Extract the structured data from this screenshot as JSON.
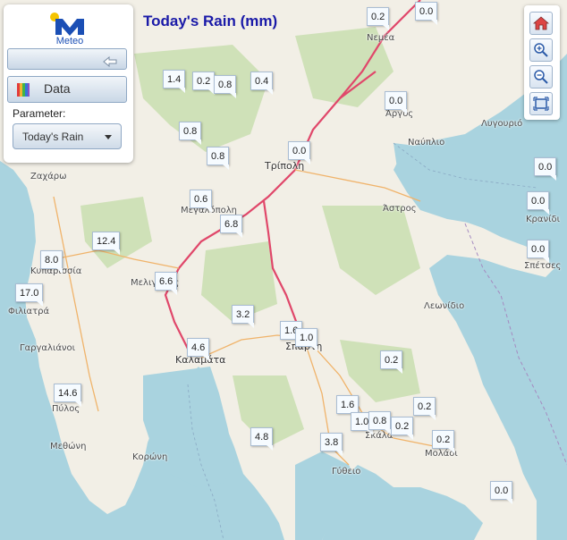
{
  "title": "Today's Rain (mm)",
  "panel": {
    "logo_text": "Meteo",
    "data_button": "Data",
    "parameter_label": "Parameter:",
    "parameter_value": "Today's Rain"
  },
  "toolbar": [
    "home-icon",
    "zoom-in-icon",
    "zoom-out-icon",
    "full-extent-icon"
  ],
  "colors": {
    "sea": "#a9d3df",
    "land": "#f2efe6",
    "forest": "#cfe1b8",
    "road": "#e0476a",
    "title": "#1a1aa8"
  },
  "markers": [
    {
      "value": "0.2"
    },
    {
      "value": "0.0"
    },
    {
      "value": "1.4"
    },
    {
      "value": "0.2"
    },
    {
      "value": "0.8"
    },
    {
      "value": "0.4"
    },
    {
      "value": "0.0"
    },
    {
      "value": "0.8"
    },
    {
      "value": "0.8"
    },
    {
      "value": "0.0"
    },
    {
      "value": "0.6"
    },
    {
      "value": "0.0"
    },
    {
      "value": "6.8"
    },
    {
      "value": "0.0"
    },
    {
      "value": "12.4"
    },
    {
      "value": "0.0"
    },
    {
      "value": "8.0"
    },
    {
      "value": "6.6"
    },
    {
      "value": "17.0"
    },
    {
      "value": "3.2"
    },
    {
      "value": "1.6"
    },
    {
      "value": "1.0"
    },
    {
      "value": "4.6"
    },
    {
      "value": "0.2"
    },
    {
      "value": "14.6"
    },
    {
      "value": "1.6"
    },
    {
      "value": "0.2"
    },
    {
      "value": "1.0"
    },
    {
      "value": "0.8"
    },
    {
      "value": "0.2"
    },
    {
      "value": "4.8"
    },
    {
      "value": "3.8"
    },
    {
      "value": "0.2"
    },
    {
      "value": "0.0"
    }
  ],
  "places": [
    {
      "name": "Νεμέα"
    },
    {
      "name": "Άργος"
    },
    {
      "name": "Λυγουριό"
    },
    {
      "name": "Ναύπλιο"
    },
    {
      "name": "Τρίπολη"
    },
    {
      "name": "Ζαχάρω"
    },
    {
      "name": "Μεγαλόπολη"
    },
    {
      "name": "Άστρος"
    },
    {
      "name": "Κρανίδι"
    },
    {
      "name": "Σπέτσες"
    },
    {
      "name": "Κυπαρισσία"
    },
    {
      "name": "Μελιγαλάς"
    },
    {
      "name": "Φιλιατρά"
    },
    {
      "name": "Λεωνίδιο"
    },
    {
      "name": "Γαργαλιάνοι"
    },
    {
      "name": "Σπάρτη"
    },
    {
      "name": "Καλαμάτα"
    },
    {
      "name": "Πύλος"
    },
    {
      "name": "Σκάλα"
    },
    {
      "name": "Μεθώνη"
    },
    {
      "name": "Μολάοι"
    },
    {
      "name": "Κορώνη"
    },
    {
      "name": "Γύθειο"
    }
  ]
}
